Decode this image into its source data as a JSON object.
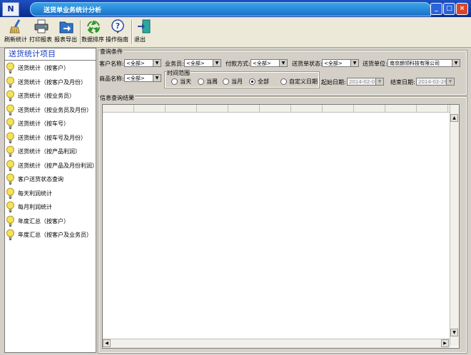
{
  "window": {
    "title": "送货单业务统计分析",
    "app_icon": "N"
  },
  "toolbar": [
    {
      "label": "刷新统计",
      "icon": "broom-icon"
    },
    {
      "label": "打印报表",
      "icon": "printer-icon"
    },
    {
      "label": "报表导出",
      "icon": "export-icon"
    },
    {
      "label": "数据排序",
      "icon": "recycle-icon"
    },
    {
      "label": "操作指南",
      "icon": "help-icon"
    },
    {
      "label": "退出",
      "icon": "exit-door-icon"
    }
  ],
  "sidebar": {
    "title": "送货统计项目",
    "items": [
      "送货统计（按客户）",
      "送货统计（按客户及月份）",
      "送货统计（按业务员）",
      "送货统计（按业务员及月份）",
      "送货统计（按车号）",
      "送货统计（按车号及月份）",
      "送货统计（按产品利润）",
      "送货统计（按产品及月份利润）",
      "客户送货状态查询",
      "每天利润统计",
      "每月利润统计",
      "年度汇总（按客户）",
      "年度汇总（按客户及业务员）"
    ]
  },
  "query": {
    "legend": "查询条件",
    "customer_label": "客户名称:",
    "customer_value": "<全部>",
    "salesman_label": "业务员:",
    "salesman_value": "<全部>",
    "payment_label": "付款方式:",
    "payment_value": "<全部>",
    "status_label": "送货单状态:",
    "status_value": "<全部>",
    "unit_label": "送货单位:",
    "unit_value": "南京朗领科技有限公司",
    "product_label": "商品名称:",
    "product_value": "<全部>",
    "time_legend": "时间范围",
    "time_options": [
      "当天",
      "当周",
      "当月",
      "全部",
      "自定义日期"
    ],
    "time_selected": "全部",
    "start_label": "起始日期:",
    "start_value": "2014-02-01",
    "end_label": "结束日期:",
    "end_value": "2014-02-28"
  },
  "results": {
    "legend": "信息查询结果"
  },
  "colors": {
    "titlebar": "#0a2a8c",
    "title_tab": "#2a8ae0",
    "sidebar_title": "#1a3cc0",
    "bulb": "#f5e25a"
  }
}
